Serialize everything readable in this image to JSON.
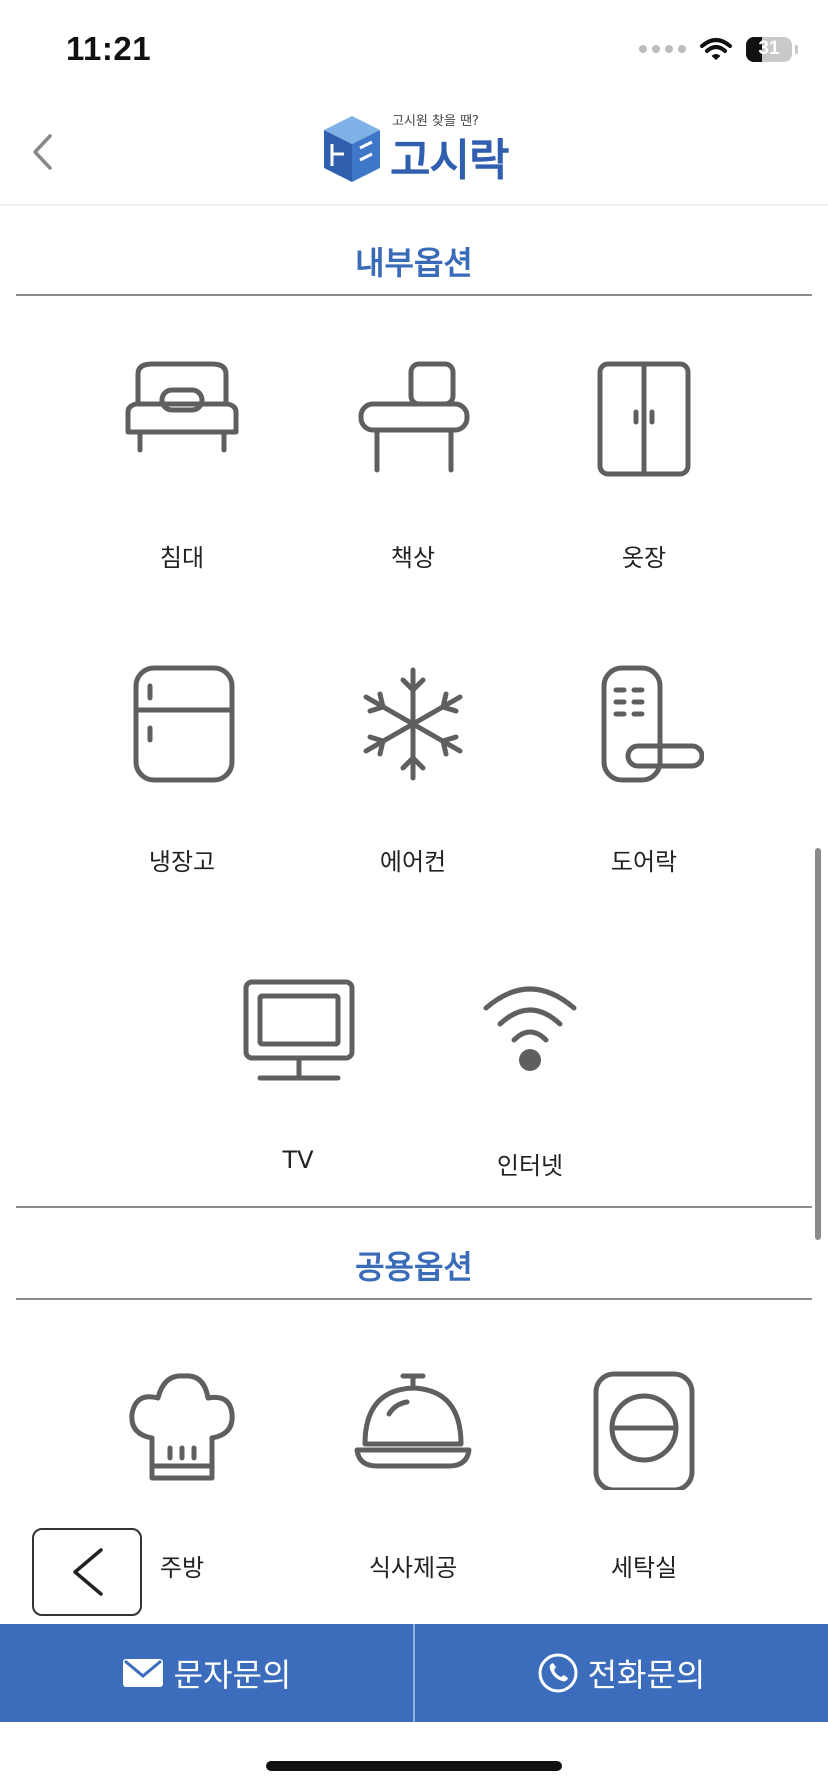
{
  "status": {
    "time": "11:21",
    "battery": "31"
  },
  "header": {
    "logo_tagline": "고시원 찾을 땐?",
    "logo_text": "고시락"
  },
  "internal": {
    "title": "내부옵션",
    "items": [
      {
        "label": "침대",
        "icon": "bed-icon"
      },
      {
        "label": "책상",
        "icon": "desk-icon"
      },
      {
        "label": "옷장",
        "icon": "wardrobe-icon"
      },
      {
        "label": "냉장고",
        "icon": "refrigerator-icon"
      },
      {
        "label": "에어컨",
        "icon": "snowflake-icon"
      },
      {
        "label": "도어락",
        "icon": "door-lock-icon"
      },
      {
        "label": "TV",
        "icon": "tv-icon"
      },
      {
        "label": "인터넷",
        "icon": "wifi-icon"
      }
    ]
  },
  "shared": {
    "title": "공용옵션",
    "items": [
      {
        "label": "주방",
        "icon": "chef-hat-icon"
      },
      {
        "label": "식사제공",
        "icon": "cloche-icon"
      },
      {
        "label": "세탁실",
        "icon": "washing-machine-icon"
      }
    ]
  },
  "bottom": {
    "sms_label": "문자문의",
    "call_label": "전화문의"
  },
  "colors": {
    "accent": "#3c6dbc",
    "title": "#3a6bb9",
    "icon": "#5f5f5f"
  }
}
